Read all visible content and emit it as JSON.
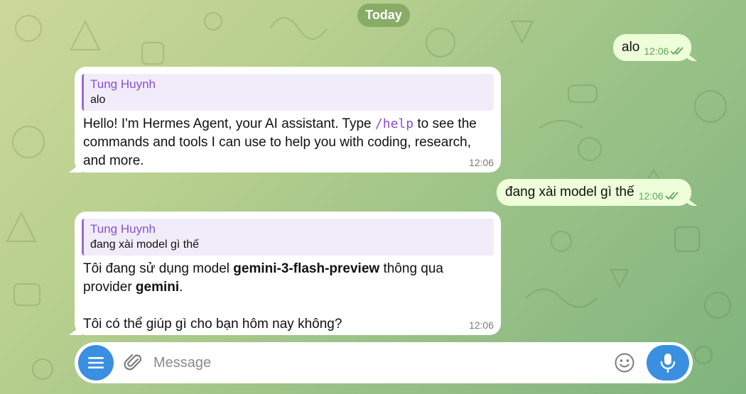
{
  "date_chip": "Today",
  "messages": [
    {
      "text": "alo",
      "time": "12:06"
    },
    {
      "reply_name": "Tung Huynh",
      "reply_text": "alo",
      "parts": [
        "Hello! I'm Hermes Agent, your AI assistant. Type ",
        "/help",
        " to see the commands and tools I can use to help you with coding, research, and more."
      ],
      "time": "12:06"
    },
    {
      "text": "đang xài model gì thế",
      "time": "12:06"
    },
    {
      "reply_name": "Tung Huynh",
      "reply_text": "đang xài model gì thế",
      "parts": [
        "Tôi đang sử dụng model ",
        "gemini-3-flash-preview",
        " thông qua provider ",
        "gemini",
        "."
      ],
      "line2": "Tôi có thể giúp gì cho bạn hôm nay không?",
      "time": "12:06"
    }
  ],
  "composer": {
    "placeholder": "Message"
  },
  "colors": {
    "outgoing_bubble": "#eefed9",
    "incoming_bubble": "#ffffff",
    "accent": "#3a8fe0",
    "reply_name": "#8a4fd0",
    "read_check": "#5fa75a"
  },
  "icons": {
    "menu": "menu-icon",
    "attach": "paperclip-icon",
    "emoji": "smiley-icon",
    "mic": "microphone-icon",
    "read": "double-check-icon"
  }
}
